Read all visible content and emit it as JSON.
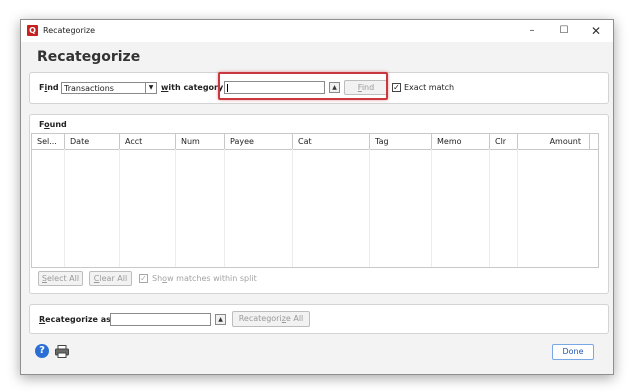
{
  "window": {
    "title": "Recategorize",
    "app_icon_glyph": "Q",
    "controls": {
      "minimize": "–",
      "maximize": "☐",
      "close": "✕"
    }
  },
  "heading": "Recategorize",
  "find": {
    "label_prefix": "F",
    "label_underlined": "i",
    "label_suffix": "nd",
    "type_value": "Transactions",
    "with_category_prefix": "",
    "with_category_underlined": "w",
    "with_category_suffix": "ith category",
    "category_value": "",
    "find_button_prefix": "",
    "find_button_underlined": "F",
    "find_button_suffix": "ind",
    "exact_match_label": "Exact match",
    "exact_match_checked": true
  },
  "found": {
    "label_prefix": "F",
    "label_underlined": "o",
    "label_suffix": "und",
    "columns": [
      "Sel...",
      "Date",
      "Acct",
      "Num",
      "Payee",
      "Cat",
      "Tag",
      "Memo",
      "Clr",
      "Amount"
    ],
    "rows": [],
    "select_all_prefix": "",
    "select_all_underlined": "S",
    "select_all_suffix": "elect All",
    "clear_all_prefix": "",
    "clear_all_underlined": "C",
    "clear_all_suffix": "lear All",
    "show_matches_prefix": "Sh",
    "show_matches_underlined": "o",
    "show_matches_suffix": "w matches within split",
    "show_matches_checked": true
  },
  "recategorize": {
    "label_prefix": "",
    "label_underlined": "R",
    "label_suffix": "ecategorize as",
    "value": "",
    "button_prefix": "Recategori",
    "button_underlined": "z",
    "button_suffix": "e All"
  },
  "footer": {
    "help_glyph": "?",
    "done_label": "Done"
  },
  "colors": {
    "highlight": "#c8393f",
    "app_icon": "#c81f1f",
    "help": "#2b6fd6",
    "done_text": "#2456b5"
  }
}
